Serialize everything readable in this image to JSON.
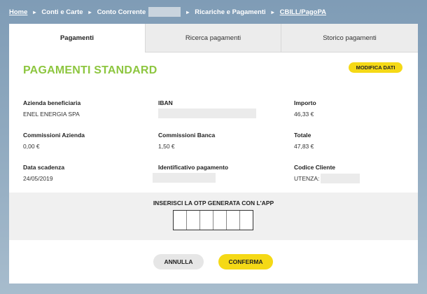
{
  "breadcrumb": {
    "home": "Home",
    "conti": "Conti e Carte",
    "conto": "Conto Corrente",
    "ricariche": "Ricariche e Pagamenti",
    "cbill": "CBILL/PagoPA",
    "separator": "▸"
  },
  "tabs": {
    "pagamenti": "Pagamenti",
    "ricerca": "Ricerca pagamenti",
    "storico": "Storico pagamenti"
  },
  "page": {
    "title": "PAGAMENTI STANDARD",
    "modify_label": "MODIFICA DATI"
  },
  "fields": {
    "azienda_label": "Azienda beneficiaria",
    "azienda_value": "ENEL ENERGIA SPA",
    "iban_label": "IBAN",
    "importo_label": "Importo",
    "importo_value": "46,33 €",
    "comm_azienda_label": "Commissioni Azienda",
    "comm_azienda_value": "0,00 €",
    "comm_banca_label": "Commissioni Banca",
    "comm_banca_value": "1,50 €",
    "totale_label": "Totale",
    "totale_value": "47,83 €",
    "scadenza_label": "Data scadenza",
    "scadenza_value": "24/05/2019",
    "identificativo_label": "Identificativo pagamento",
    "codice_label": "Codice Cliente",
    "codice_value": "UTENZA:"
  },
  "otp": {
    "label": "INSERISCI LA OTP GENERATA CON L'APP"
  },
  "actions": {
    "cancel_label": "ANNULLA",
    "confirm_label": "CONFERMA"
  }
}
